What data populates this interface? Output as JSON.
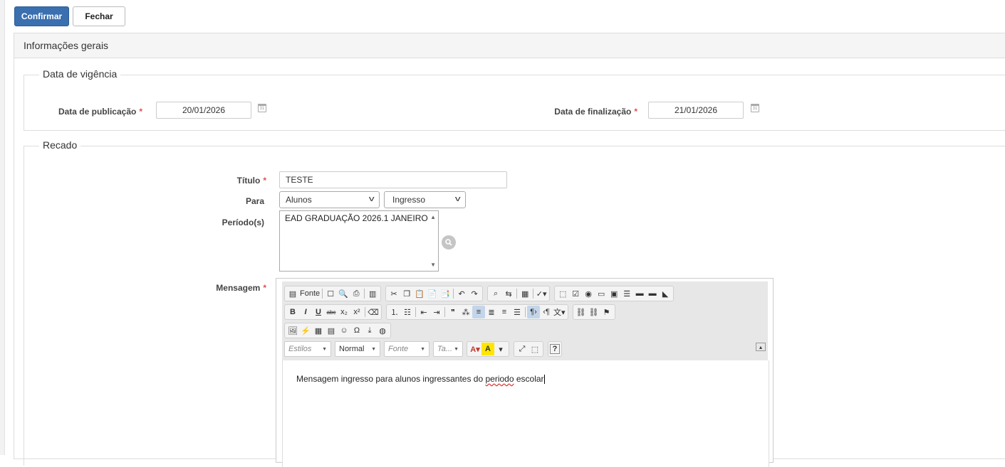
{
  "toolbar": {
    "confirm_label": "Confirmar",
    "close_label": "Fechar"
  },
  "panel": {
    "title": "Informações gerais"
  },
  "validity": {
    "legend": "Data de vigência",
    "publication_label": "Data de publicação",
    "publication_value": "20/01/2026",
    "end_label": "Data de finalização",
    "end_value": "21/01/2026",
    "required_mark": "*"
  },
  "message_section": {
    "legend": "Recado",
    "title_label": "Título",
    "title_value": "TESTE",
    "to_label": "Para",
    "to_selected": "Alunos",
    "to_type_selected": "Ingresso",
    "periods_label": "Período(s)",
    "periods_options": [
      "EAD GRADUAÇÃO 2026.1 JANEIRO"
    ],
    "message_label": "Mensagem"
  },
  "editor": {
    "source_label": "Fonte",
    "styles_placeholder": "Estilos",
    "format_value": "Normal",
    "font_placeholder": "Fonte",
    "size_placeholder": "Ta...",
    "help_label": "?",
    "content_before": "Mensagem ingresso para alunos ingressantes do ",
    "content_misspelled": "periodo",
    "content_after": " escolar"
  }
}
